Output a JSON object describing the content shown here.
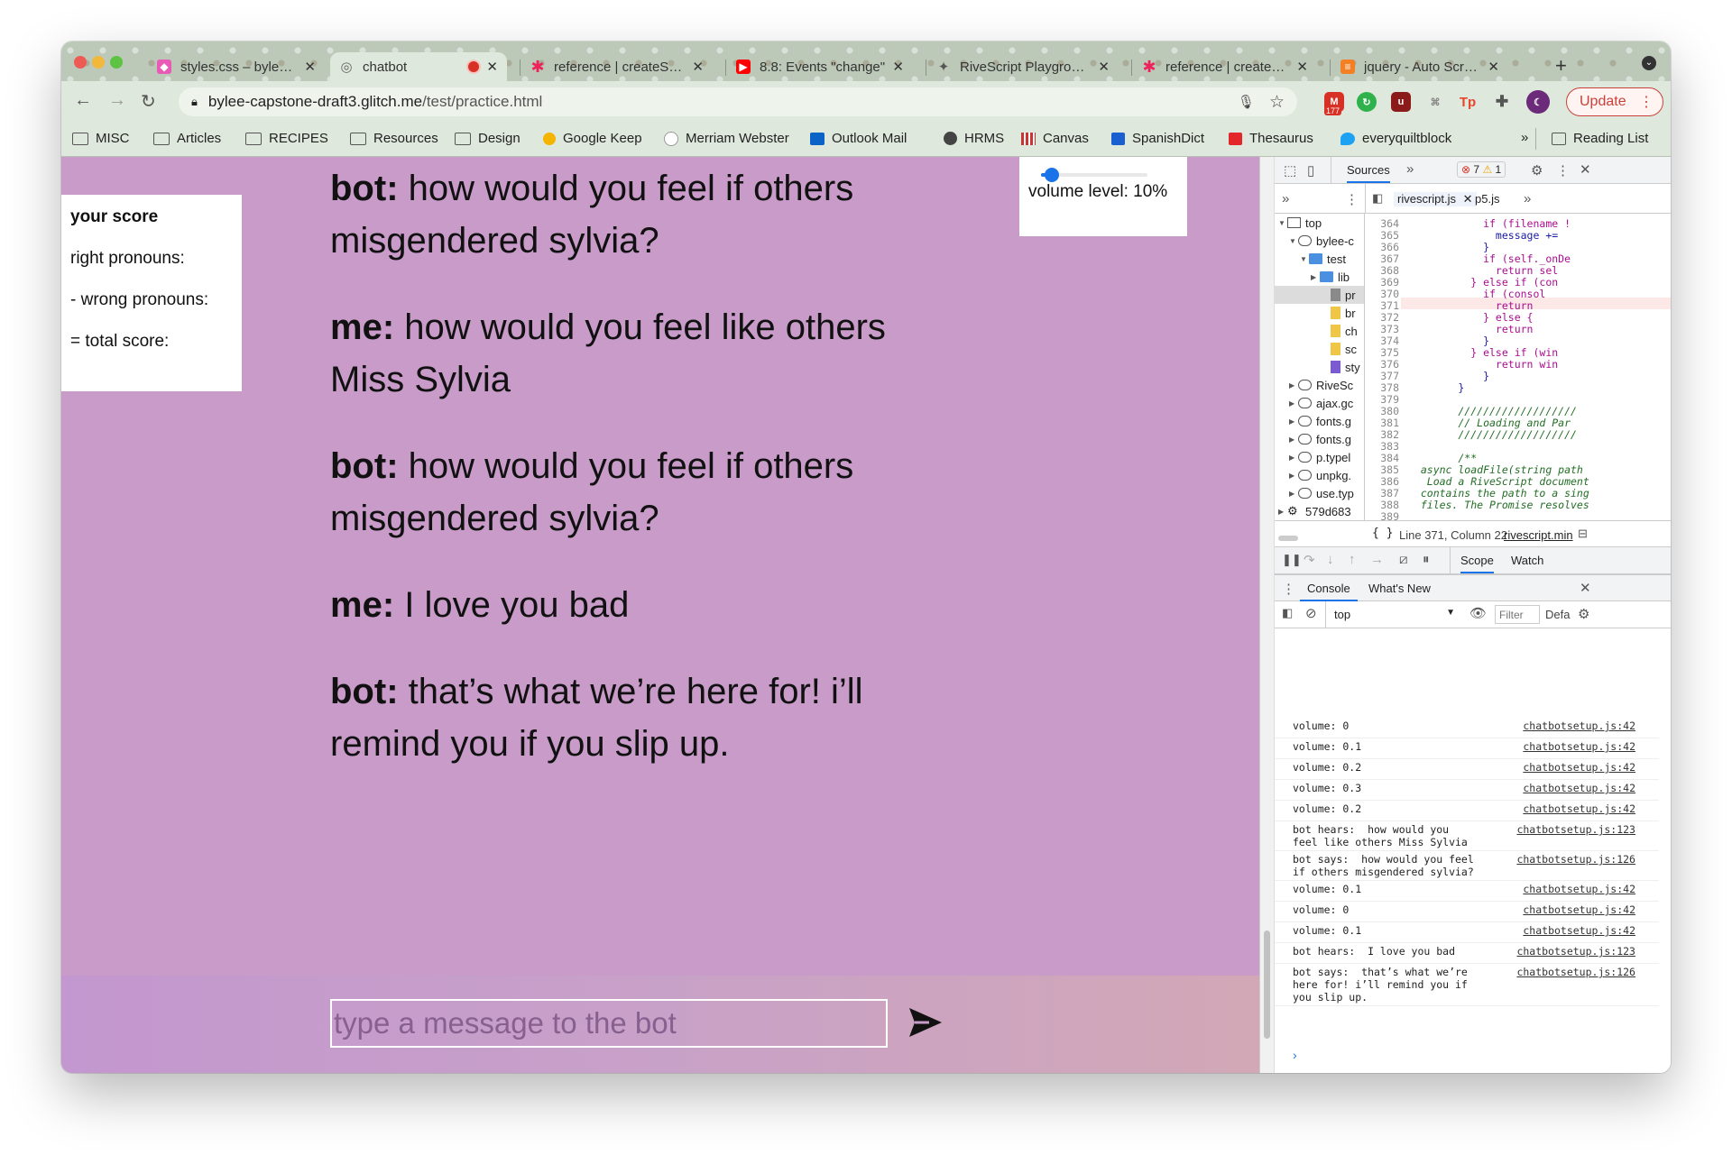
{
  "tabs": [
    {
      "title": "styles.css – bylee-capstone",
      "favicon": "glitch-fish-icon",
      "closable": true
    },
    {
      "title": "chatbot",
      "favicon": "globe-icon",
      "closable": true,
      "active": true
    },
    {
      "title": "reference | createSpan",
      "favicon": "p5-star-icon",
      "closable": true
    },
    {
      "title": "8.8: Events \"change\"",
      "favicon": "youtube-icon",
      "closable": true
    },
    {
      "title": "RiveScript Playground",
      "favicon": "rivescript-icon",
      "closable": true
    },
    {
      "title": "reference | createSlider",
      "favicon": "p5-star-icon",
      "closable": true
    },
    {
      "title": "jquery - Auto Scroll to",
      "favicon": "stack-overflow-icon",
      "closable": true
    }
  ],
  "toolbar": {
    "url_host": "bylee-capstone-draft3.glitch.me",
    "url_path": "/test/practice.html",
    "gmail_badge": "177",
    "update_label": "Update"
  },
  "bookmarks": [
    {
      "label": "MISC",
      "icon": "folder-icon"
    },
    {
      "label": "Articles",
      "icon": "folder-icon"
    },
    {
      "label": "RECIPES",
      "icon": "folder-icon"
    },
    {
      "label": "Resources",
      "icon": "folder-icon"
    },
    {
      "label": "Design",
      "icon": "folder-icon"
    },
    {
      "label": "Google Keep",
      "icon": "keep-icon"
    },
    {
      "label": "Merriam Webster",
      "icon": "mw-icon"
    },
    {
      "label": "Outlook Mail",
      "icon": "outlook-icon"
    },
    {
      "label": "HRMS",
      "icon": "globe-icon"
    },
    {
      "label": "Canvas",
      "icon": "canvas-icon"
    },
    {
      "label": "SpanishDict",
      "icon": "spanishdict-icon"
    },
    {
      "label": "Thesaurus",
      "icon": "thesaurus-icon"
    },
    {
      "label": "everyquiltblock",
      "icon": "twitter-icon"
    }
  ],
  "bookmarks_more": "»",
  "reading_list": "Reading List",
  "page": {
    "score": {
      "title": "your score",
      "right": "right pronouns:",
      "wrong": "- wrong pronouns:",
      "total": "= total score:"
    },
    "volume": {
      "label": "volume level: 10%",
      "fraction": 0.1
    },
    "messages": [
      {
        "speaker": "bot:",
        "text": " how would you feel if others misgendered sylvia?"
      },
      {
        "speaker": "me:",
        "text": " how would you feel like others Miss Sylvia"
      },
      {
        "speaker": "bot:",
        "text": " how would you feel if others misgendered sylvia?"
      },
      {
        "speaker": "me:",
        "text": " I love you bad"
      },
      {
        "speaker": "bot:",
        "text": " that’s what we’re here for! i’ll remind you if you slip up."
      }
    ],
    "input_placeholder": "type a message to the bot",
    "colors": {
      "page_bg": "#c89bc9",
      "input_border": "#ffffff"
    }
  },
  "devtools": {
    "panel_tab": "Sources",
    "errors": "7",
    "warnings": "1",
    "file_tabs": [
      "rivescript.js",
      "p5.js"
    ],
    "tree": [
      {
        "label": "top",
        "indent": 0,
        "icon": "frame-icon"
      },
      {
        "label": "bylee-c",
        "indent": 1,
        "icon": "cloud-icon"
      },
      {
        "label": "test",
        "indent": 2,
        "icon": "folder-blue-icon"
      },
      {
        "label": "lib",
        "indent": 3,
        "icon": "folder-blue-icon"
      },
      {
        "label": "pr",
        "indent": 4,
        "icon": "file-gray-icon",
        "selected": true
      },
      {
        "label": "br",
        "indent": 4,
        "icon": "file-yellow-icon"
      },
      {
        "label": "ch",
        "indent": 4,
        "icon": "file-yellow-icon"
      },
      {
        "label": "sc",
        "indent": 4,
        "icon": "file-yellow-icon"
      },
      {
        "label": "sty",
        "indent": 4,
        "icon": "file-purple-icon"
      },
      {
        "label": "RiveSc",
        "indent": 1,
        "icon": "cloud-icon"
      },
      {
        "label": "ajax.gc",
        "indent": 1,
        "icon": "cloud-icon"
      },
      {
        "label": "fonts.g",
        "indent": 1,
        "icon": "cloud-icon"
      },
      {
        "label": "fonts.g",
        "indent": 1,
        "icon": "cloud-icon"
      },
      {
        "label": "p.typel",
        "indent": 1,
        "icon": "cloud-icon"
      },
      {
        "label": "unpkg.",
        "indent": 1,
        "icon": "cloud-icon"
      },
      {
        "label": "use.typ",
        "indent": 1,
        "icon": "cloud-icon"
      },
      {
        "label": "579d683",
        "indent": 0,
        "icon": "gear-icon"
      }
    ],
    "code": [
      {
        "n": "364",
        "t": "            if (filename !",
        "c": "kw"
      },
      {
        "n": "365",
        "t": "              message +=",
        "c": ""
      },
      {
        "n": "366",
        "t": "            }",
        "c": ""
      },
      {
        "n": "367",
        "t": "            if (self._onDe",
        "c": "kw"
      },
      {
        "n": "368",
        "t": "              return sel",
        "c": "kw"
      },
      {
        "n": "369",
        "t": "          } else if (con",
        "c": "kw"
      },
      {
        "n": "370",
        "t": "            if (consol",
        "c": "kw"
      },
      {
        "n": "371",
        "t": "              return",
        "c": "kw"
      },
      {
        "n": "372",
        "t": "            } else {",
        "c": "kw"
      },
      {
        "n": "373",
        "t": "              return",
        "c": "kw"
      },
      {
        "n": "374",
        "t": "            }",
        "c": ""
      },
      {
        "n": "375",
        "t": "          } else if (win",
        "c": "kw"
      },
      {
        "n": "376",
        "t": "              return win",
        "c": "kw"
      },
      {
        "n": "377",
        "t": "            }",
        "c": ""
      },
      {
        "n": "378",
        "t": "        }",
        "c": ""
      },
      {
        "n": "379",
        "t": "",
        "c": ""
      },
      {
        "n": "380",
        "t": "        ///////////////////",
        "c": "cm"
      },
      {
        "n": "381",
        "t": "        // Loading and Par",
        "c": "cm"
      },
      {
        "n": "382",
        "t": "        ///////////////////",
        "c": "cm"
      },
      {
        "n": "383",
        "t": "",
        "c": ""
      },
      {
        "n": "384",
        "t": "        /**",
        "c": "cm"
      },
      {
        "n": "385",
        "t": "  async loadFile(string path",
        "c": "cm"
      },
      {
        "n": "386",
        "t": "   Load a RiveScript document",
        "c": "cm"
      },
      {
        "n": "387",
        "t": "  contains the path to a sing",
        "c": "cm"
      },
      {
        "n": "388",
        "t": "  files. The Promise resolves",
        "c": "cm"
      },
      {
        "n": "389",
        "t": "",
        "c": ""
      }
    ],
    "status_line": "Line 371, Column 22",
    "status_file": "rivescript.min",
    "debug_tabs": [
      "Scope",
      "Watch"
    ],
    "drawer_tabs": [
      "Console",
      "What's New"
    ],
    "context": "top",
    "filter_placeholder": "Filter",
    "levels": "Defa",
    "logs": [
      {
        "text": "volume: 0",
        "src": "chatbotsetup.js:42"
      },
      {
        "text": "volume: 0.1",
        "src": "chatbotsetup.js:42"
      },
      {
        "text": "volume: 0.2",
        "src": "chatbotsetup.js:42"
      },
      {
        "text": "volume: 0.3",
        "src": "chatbotsetup.js:42"
      },
      {
        "text": "volume: 0.2",
        "src": "chatbotsetup.js:42"
      },
      {
        "text": "bot hears:  how would you feel like others Miss Sylvia",
        "src": "chatbotsetup.js:123"
      },
      {
        "text": "bot says:  how would you feel if others misgendered sylvia?",
        "src": "chatbotsetup.js:126"
      },
      {
        "text": "volume: 0.1",
        "src": "chatbotsetup.js:42"
      },
      {
        "text": "volume: 0",
        "src": "chatbotsetup.js:42"
      },
      {
        "text": "volume: 0.1",
        "src": "chatbotsetup.js:42"
      },
      {
        "text": "bot hears:  I love you bad",
        "src": "chatbotsetup.js:123"
      },
      {
        "text": "bot says:  that’s what we’re here for! i’ll remind you if you slip up.",
        "src": "chatbotsetup.js:126"
      }
    ],
    "prompt": "›"
  }
}
